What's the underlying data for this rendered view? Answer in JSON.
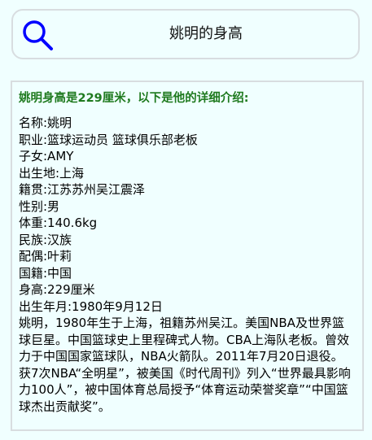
{
  "search": {
    "query": "姚明的身高",
    "icon": "search-icon",
    "icon_color": "#0000ff"
  },
  "result": {
    "heading": "姚明身高是229厘米，以下是他的详细介绍:",
    "heading_color": "#1f7a1f",
    "lines": [
      "名称:姚明",
      "职业:篮球运动员 篮球俱乐部老板",
      "子女:AMY",
      "出生地:上海",
      "籍贯:江苏苏州吴江震泽",
      "性别:男",
      "体重:140.6kg",
      "民族:汉族",
      "配偶:叶莉",
      "国籍:中国",
      "身高:229厘米",
      "出生年月:1980年9月12日"
    ],
    "bio": "姚明，1980年生于上海，祖籍苏州吴江。美国NBA及世界篮球巨星。中国篮球史上里程碑式人物。CBA上海队老板。曾效力于中国国家篮球队，NBA火箭队。2011年7月20日退役。获7次NBA“全明星”，被美国《时代周刊》列入“世界最具影响力100人”，被中国体育总局授予“体育运动荣誉奖章”“中国篮球杰出贡献奖”。"
  }
}
